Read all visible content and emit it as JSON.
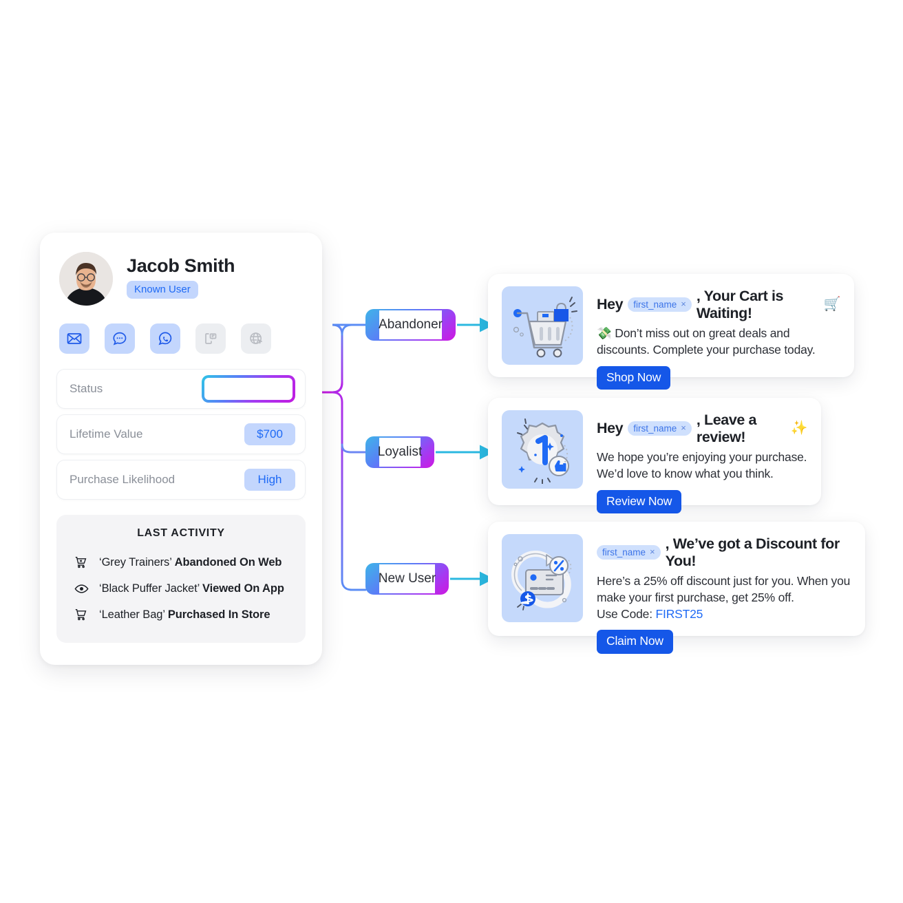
{
  "profile": {
    "name": "Jacob Smith",
    "badge": "Known User",
    "avatar_icon": "user-photo",
    "channels": [
      {
        "name": "email-channel-icon",
        "label": "Email",
        "state": "active"
      },
      {
        "name": "sms-chat-channel-icon",
        "label": "SMS",
        "state": "active"
      },
      {
        "name": "whatsapp-channel-icon",
        "label": "WhatsApp",
        "state": "active"
      },
      {
        "name": "in-app-message-channel-icon",
        "label": "In-App Message",
        "state": "muted"
      },
      {
        "name": "web-push-channel-icon",
        "label": "Web Push",
        "state": "muted"
      }
    ],
    "rows": [
      {
        "label": "Status",
        "value": "",
        "type": "input"
      },
      {
        "label": "Lifetime Value",
        "value": "$700",
        "type": "badge"
      },
      {
        "label": "Purchase Likelihood",
        "value": "High",
        "type": "badge"
      }
    ],
    "activity": {
      "title": "LAST ACTIVITY",
      "items": [
        {
          "icon": "cart-remove-icon",
          "product": "‘Grey Trainers’",
          "action": "Abandoned On Web"
        },
        {
          "icon": "eye-icon",
          "product": "‘Black Puffer Jacket’",
          "action": "Viewed On App"
        },
        {
          "icon": "cart-icon",
          "product": "‘Leather Bag’",
          "action": "Purchased In Store"
        }
      ]
    }
  },
  "segments": [
    {
      "label": "Abandoner"
    },
    {
      "label": "Loyalist"
    },
    {
      "label": "New User"
    }
  ],
  "messages": [
    {
      "illustration": "shopping-cart-illustration",
      "title_prefix": "Hey",
      "token": "first_name",
      "token_remove": "×",
      "title_suffix": ", Your Cart is Waiting!",
      "title_emoji": "🛒",
      "body": "💸 Don’t miss out on great deals and discounts. Complete your purchase today.",
      "cta": "Shop Now"
    },
    {
      "illustration": "review-badge-illustration",
      "title_prefix": "Hey",
      "token": "first_name",
      "token_remove": "×",
      "title_suffix": ", Leave a review!",
      "title_emoji": "✨",
      "body": "We hope you’re enjoying your purchase. We’d love to know what you think.",
      "cta": "Review Now"
    },
    {
      "illustration": "discount-card-illustration",
      "title_prefix": "",
      "token": "first_name",
      "token_remove": "×",
      "title_suffix": ", We’ve got a Discount for You!",
      "title_emoji": "",
      "body": "Here’s a 25% off discount just for you. When you make your first purchase, get 25% off.",
      "body_line2_label": "Use Code: ",
      "body_line2_code": "FIRST25",
      "cta": "Claim Now"
    }
  ],
  "colors": {
    "accent_blue": "#1f6af5",
    "cta_blue": "#1557e8",
    "chip_blue": "#c3d6fd",
    "thumb_blue": "#c5d9fb",
    "arrow_cyan": "#2bb8e0",
    "gradient_start": "#2ec6e6",
    "gradient_end": "#cf17e0",
    "text_dark": "#1d2026",
    "text_muted": "#8a8f98"
  }
}
